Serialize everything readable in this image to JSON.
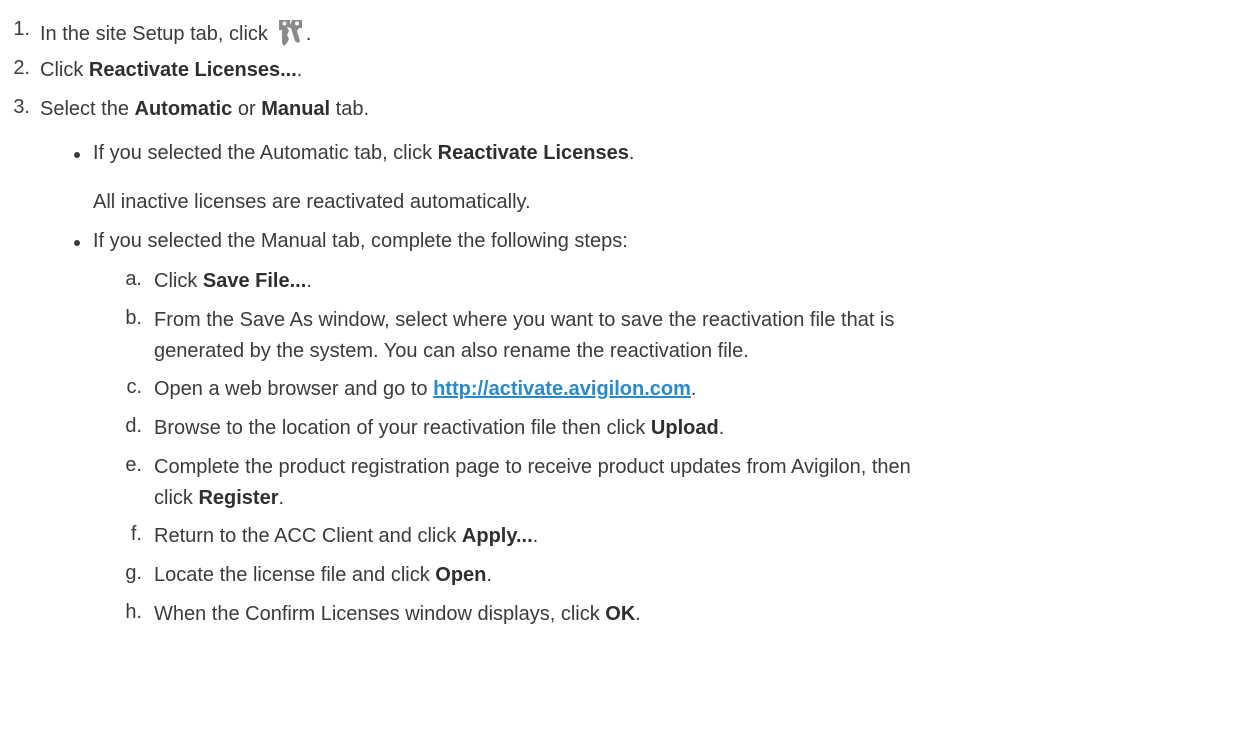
{
  "steps": [
    {
      "num": "1.",
      "before": "In the site Setup tab, click",
      "after": "."
    },
    {
      "num": "2.",
      "before": "Click ",
      "bold": "Reactivate Licenses...",
      "after": "."
    },
    {
      "num": "3.",
      "before": "Select the ",
      "bold1": "Automatic",
      "mid": " or ",
      "bold2": "Manual",
      "after": " tab."
    }
  ],
  "auto": {
    "before": "If you selected the Automatic tab, click ",
    "bold": "Reactivate Licenses",
    "after": ".",
    "note": "All inactive licenses are reactivated automatically."
  },
  "manual": {
    "intro": "If you selected the Manual tab, complete the following steps:",
    "a": {
      "letter": "a.",
      "before": "Click ",
      "bold": "Save File...",
      "after": "."
    },
    "b": {
      "letter": "b.",
      "line1": "From the Save As window, select where you want to save the reactivation file that is",
      "line2": "generated by the system. You can also rename the reactivation file."
    },
    "c": {
      "letter": "c.",
      "before": "Open a web browser and go to ",
      "link": "http://activate.avigilon.com",
      "after": "."
    },
    "d": {
      "letter": "d.",
      "before": "Browse to the location of your reactivation file then click ",
      "bold": "Upload",
      "after": "."
    },
    "e": {
      "letter": "e.",
      "line1": "Complete the product registration page to receive product updates from Avigilon, then",
      "line2_before": "click ",
      "line2_bold": "Register",
      "line2_after": "."
    },
    "f": {
      "letter": "f.",
      "before": "Return to the ACC Client and click ",
      "bold": "Apply...",
      "after": "."
    },
    "g": {
      "letter": "g.",
      "before": "Locate the license file and click ",
      "bold": "Open",
      "after": "."
    },
    "h": {
      "letter": "h.",
      "before": "When the Confirm Licenses window displays, click ",
      "bold": "OK",
      "after": "."
    }
  },
  "icons": {
    "license": "keys-icon"
  },
  "colors": {
    "text": "#3b3b3b",
    "link": "#2a8ac9"
  }
}
